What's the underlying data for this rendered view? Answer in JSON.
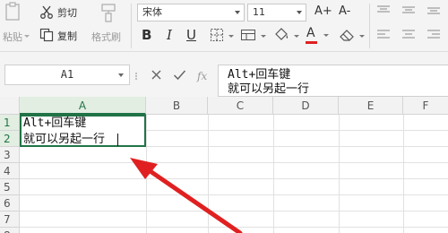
{
  "ribbon": {
    "paste_label": "粘贴",
    "cut_label": "剪切",
    "copy_label": "复制",
    "format_painter_label": "格式刷",
    "font_name": "宋体",
    "font_size": "11",
    "increase_font_label": "A+",
    "decrease_font_label": "A-",
    "bold_label": "B",
    "italic_label": "I",
    "underline_label": "U",
    "font_color_label": "A",
    "colors": {
      "font_color": "#e02020",
      "accent": "#217346"
    }
  },
  "formula_bar": {
    "name_box": "A1",
    "fx_label": "fx",
    "content_line1": "Alt+回车键",
    "content_line2": "就可以另起一行"
  },
  "sheet": {
    "columns": [
      "A",
      "B",
      "C",
      "D",
      "E",
      "F"
    ],
    "rows": [
      "1",
      "2",
      "3",
      "4",
      "5",
      "6",
      "7",
      "8"
    ],
    "cell_a1_line1": "Alt+回车键",
    "cell_a1_line2": "就可以另起一行",
    "selected_cell": "A1"
  },
  "annotation": {
    "arrow_color": "#e02020"
  }
}
